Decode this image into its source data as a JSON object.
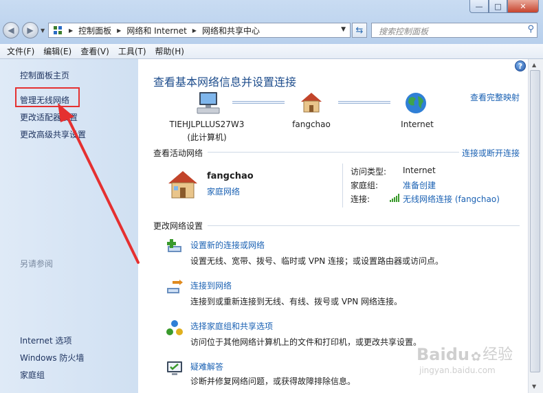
{
  "window": {
    "min_label": "—",
    "max_label": "□",
    "close_label": "✕"
  },
  "address": {
    "crumbs": [
      "控制面板",
      "网络和 Internet",
      "网络和共享中心"
    ]
  },
  "search": {
    "placeholder": "搜索控制面板"
  },
  "menu": [
    "文件(F)",
    "编辑(E)",
    "查看(V)",
    "工具(T)",
    "帮助(H)"
  ],
  "sidebar": {
    "items": [
      "控制面板主页",
      "管理无线网络",
      "更改适配器设置",
      "更改高级共享设置"
    ],
    "see_also_title": "另请参阅",
    "see_also": [
      "Internet 选项",
      "Windows 防火墙",
      "家庭组"
    ]
  },
  "main": {
    "title": "查看基本网络信息并设置连接",
    "full_map_link": "查看完整映射",
    "map": {
      "computer_name": "TIEHJLPLLUS27W3",
      "computer_note": "(此计算机)",
      "network_name": "fangchao",
      "internet_label": "Internet"
    },
    "active_title": "查看活动网络",
    "connect_link": "连接或断开连接",
    "active": {
      "name": "fangchao",
      "type": "家庭网络",
      "access_label": "访问类型:",
      "access_value": "Internet",
      "homegroup_label": "家庭组:",
      "homegroup_value": "准备创建",
      "conn_label": "连接:",
      "conn_value": "无线网络连接 (fangchao)"
    },
    "change_title": "更改网络设置",
    "tasks": [
      {
        "title": "设置新的连接或网络",
        "desc": "设置无线、宽带、拨号、临时或 VPN 连接；或设置路由器或访问点。"
      },
      {
        "title": "连接到网络",
        "desc": "连接到或重新连接到无线、有线、拨号或 VPN 网络连接。"
      },
      {
        "title": "选择家庭组和共享选项",
        "desc": "访问位于其他网络计算机上的文件和打印机，或更改共享设置。"
      },
      {
        "title": "疑难解答",
        "desc": "诊断并修复网络问题，或获得故障排除信息。"
      }
    ]
  },
  "watermark": {
    "brand": "Baidu",
    "brand_cn": "经验",
    "url": "jingyan.baidu.com"
  },
  "colors": {
    "link": "#1a61b3",
    "title": "#1e4d8c",
    "annotation": "#e53030"
  }
}
